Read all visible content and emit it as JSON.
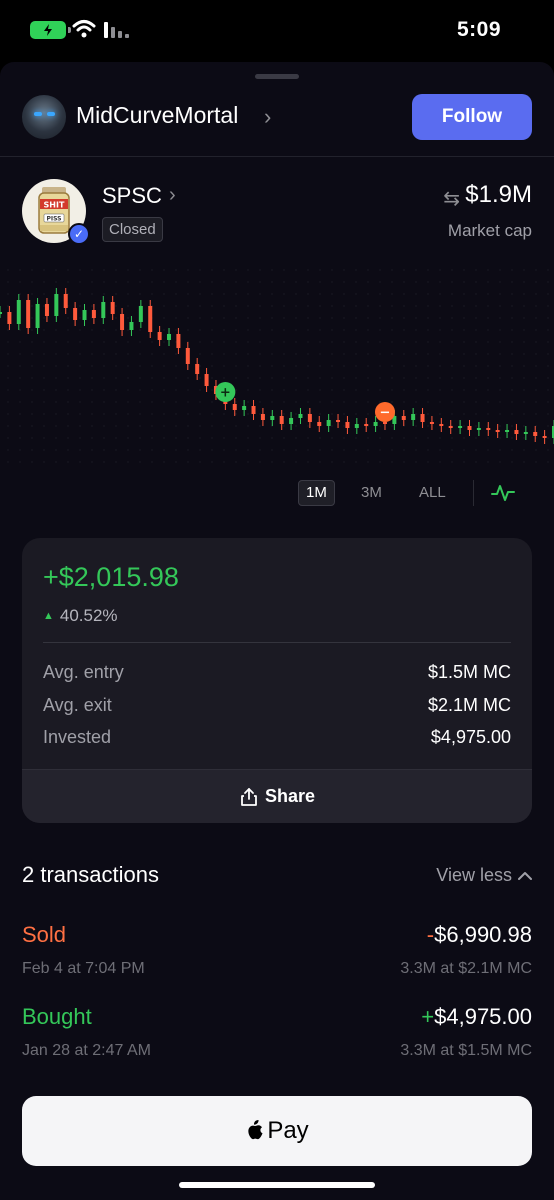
{
  "status_bar": {
    "time": "5:09",
    "battery_color": "#30d158"
  },
  "user": {
    "name": "MidCurveMortal",
    "follow_label": "Follow",
    "follow_color": "#5a6cf0"
  },
  "token": {
    "ticker": "SPSC",
    "status_badge": "Closed",
    "logo_text_top": "SHIT",
    "logo_text_bottom": "PISS",
    "market_cap_value": "$1.9M",
    "market_cap_label": "Market cap"
  },
  "chart": {
    "ranges": [
      "1M",
      "3M",
      "ALL"
    ],
    "selected_range": "1M",
    "buy_marker": "+",
    "sell_marker": "−",
    "up_color": "#34c759",
    "down_color": "#ff5a3c"
  },
  "chart_data": {
    "type": "line",
    "x": [],
    "series": [
      {
        "values": [
          9.0,
          8.4,
          9.6,
          8.2,
          9.4,
          8.8,
          9.9,
          9.2,
          8.6,
          9.1,
          8.7,
          9.5,
          8.9,
          8.1,
          8.5,
          9.3,
          8.0,
          7.6,
          7.9,
          7.2,
          6.4,
          5.9,
          5.3,
          4.9,
          4.4,
          4.1,
          4.3,
          3.9,
          3.6,
          3.8,
          3.4,
          3.7,
          3.9,
          3.5,
          3.3,
          3.6,
          3.5,
          3.2,
          3.4,
          3.3,
          3.5,
          3.4,
          3.8,
          3.6,
          3.9,
          3.5,
          3.4,
          3.3,
          3.2,
          3.3,
          3.1,
          3.2,
          3.1,
          3.0,
          3.1,
          2.9,
          3.0,
          2.8,
          2.7,
          3.3
        ],
        "color_up": "#34c759",
        "color_down": "#ff5a3c"
      }
    ],
    "markers": [
      {
        "kind": "buy",
        "index": 24
      },
      {
        "kind": "sell",
        "index": 41
      }
    ]
  },
  "pnl": {
    "value": "+$2,015.98",
    "percent": "40.52%",
    "rows": [
      {
        "label": "Avg. entry",
        "value": "$1.5M MC"
      },
      {
        "label": "Avg. exit",
        "value": "$2.1M MC"
      },
      {
        "label": "Invested",
        "value": "$4,975.00"
      }
    ],
    "share_label": "Share"
  },
  "transactions": {
    "count_label": "2 transactions",
    "toggle_label": "View less",
    "items": [
      {
        "type": "Sold",
        "sign": "-",
        "amount": "$6,990.98",
        "date": "Feb 4 at 7:04 PM",
        "detail": "3.3M at $2.1M MC"
      },
      {
        "type": "Bought",
        "sign": "+",
        "amount": "$4,975.00",
        "date": "Jan 28 at 2:47 AM",
        "detail": "3.3M at $1.5M MC"
      }
    ]
  },
  "pay_button": {
    "label": "Pay"
  }
}
